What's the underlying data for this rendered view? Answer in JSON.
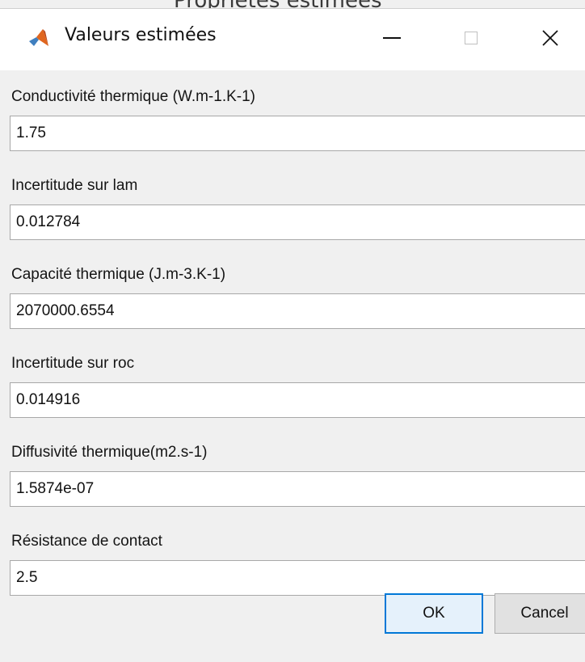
{
  "background_window": {
    "title_fragment": "Propriétés estimées"
  },
  "window": {
    "title": "Valeurs estimées",
    "icon": "matlab-logo-icon",
    "controls": {
      "minimize": "minimize-icon",
      "maximize": "maximize-icon",
      "close": "×"
    }
  },
  "fields": [
    {
      "label": "Conductivité thermique (W.m-1.K-1)",
      "value": "1.75"
    },
    {
      "label": "Incertitude sur lam",
      "value": "0.012784"
    },
    {
      "label": "Capacité thermique (J.m-3.K-1)",
      "value": "2070000.6554"
    },
    {
      "label": "Incertitude sur roc",
      "value": "0.014916"
    },
    {
      "label": "Diffusivité thermique(m2.s-1)",
      "value": "1.5874e-07"
    },
    {
      "label": "Résistance de contact",
      "value": "2.5"
    }
  ],
  "buttons": {
    "ok": "OK",
    "cancel": "Cancel"
  },
  "colors": {
    "focus_border": "#0078d7",
    "ok_background": "#e5f1fb",
    "dialog_background": "#f0f0f0"
  }
}
